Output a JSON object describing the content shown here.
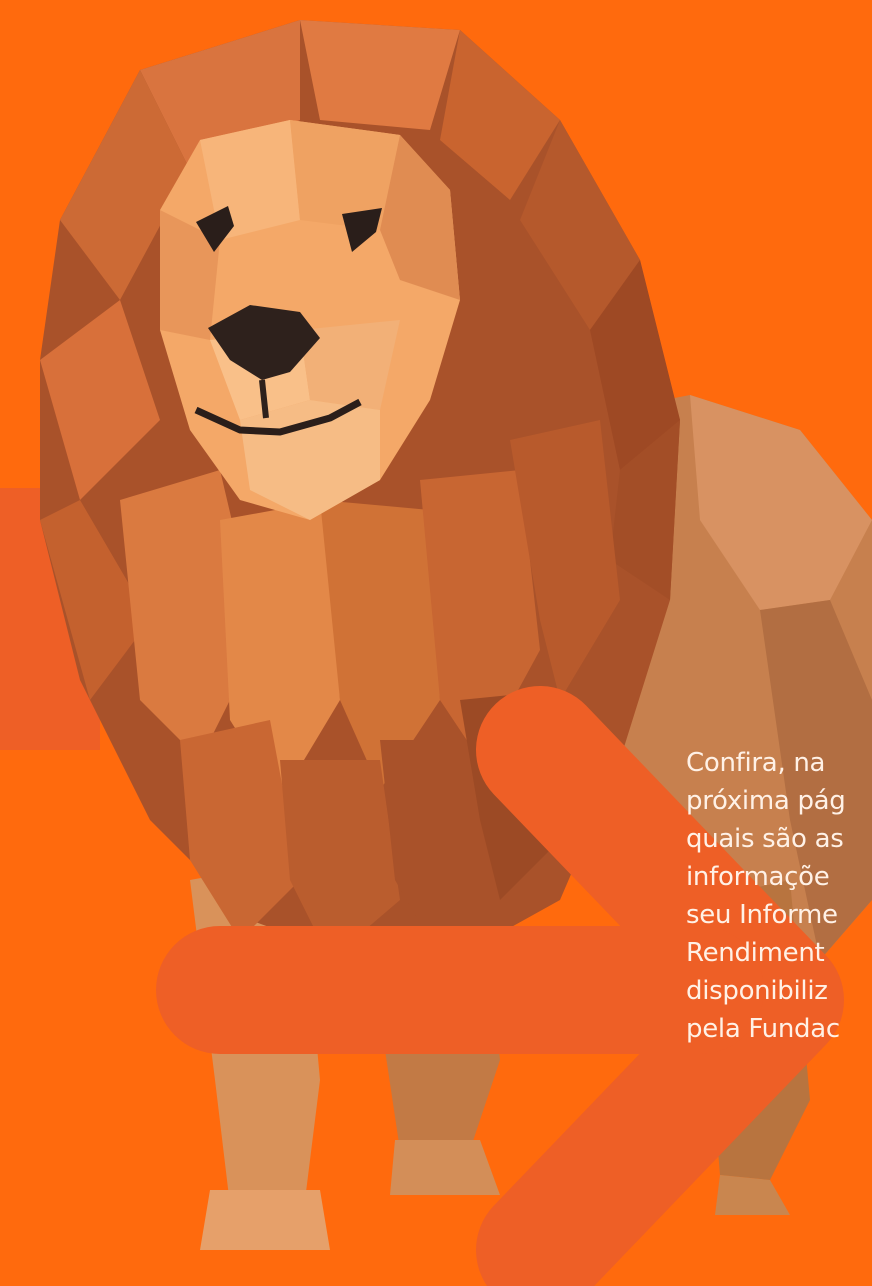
{
  "caption": {
    "text": "Confira, na\npróxima pág\nquais são as\ninformaçõe\nseu Informe\nRendiment\ndisponibiliz\npela Fundac"
  },
  "colors": {
    "background": "#FF6A0D",
    "accent_shapes": "#EE5F26",
    "text": "#FFF1E6"
  },
  "icons": [
    "paper-lion-illustration",
    "chevron-arrow-icon"
  ]
}
